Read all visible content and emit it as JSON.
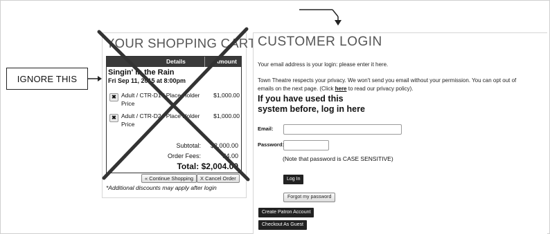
{
  "annotation": {
    "label": "IGNORE THIS"
  },
  "cart": {
    "title": "YOUR SHOPPING CART",
    "headers": {
      "details": "Details",
      "amount": "Amount"
    },
    "event": {
      "name": "Singin' in the Rain",
      "date": "Fri Sep 11, 2015 at 8:00pm"
    },
    "items": [
      {
        "remove_icon": "✖",
        "description": "Adult / CTR-D1 / Place Holder Price",
        "price": "$1,000.00"
      },
      {
        "remove_icon": "✖",
        "description": "Adult / CTR-D2 / Place Holder Price",
        "price": "$1,000.00"
      }
    ],
    "subtotal": {
      "label": "Subtotal:",
      "value": "$2,000.00"
    },
    "fees": {
      "label": "Order Fees:",
      "value": "$4.00"
    },
    "total": {
      "label": "Total:",
      "value": "$2,004.00"
    },
    "buttons": {
      "continue": "« Continue Shopping",
      "cancel": "X Cancel Order"
    },
    "discount_note": "*Additional discounts may apply after login"
  },
  "login": {
    "title": "CUSTOMER LOGIN",
    "email_intro": "Your email address is your login: please enter it here.",
    "privacy_line1": "Town Theatre respects your privacy. We won't send you email without your permission. You can opt out of",
    "privacy_line2_before": "emails on the next page. (Click ",
    "privacy_link": "here",
    "privacy_line2_after": " to read our privacy policy).",
    "used_before": "If you have used this system before, log in here",
    "email_label": "Email:",
    "email_value": "",
    "password_label": "Password:",
    "password_value": "",
    "case_note": "(Note that password is CASE SENSITIVE)",
    "buttons": {
      "login": "Log In",
      "forgot": "Forgot my password",
      "create": "Create Patron Account",
      "guest": "Checkout As Guest"
    }
  },
  "colors": {
    "cart_header": "#3a3a3a",
    "dark_button": "#222222",
    "title_gray": "#555555"
  }
}
